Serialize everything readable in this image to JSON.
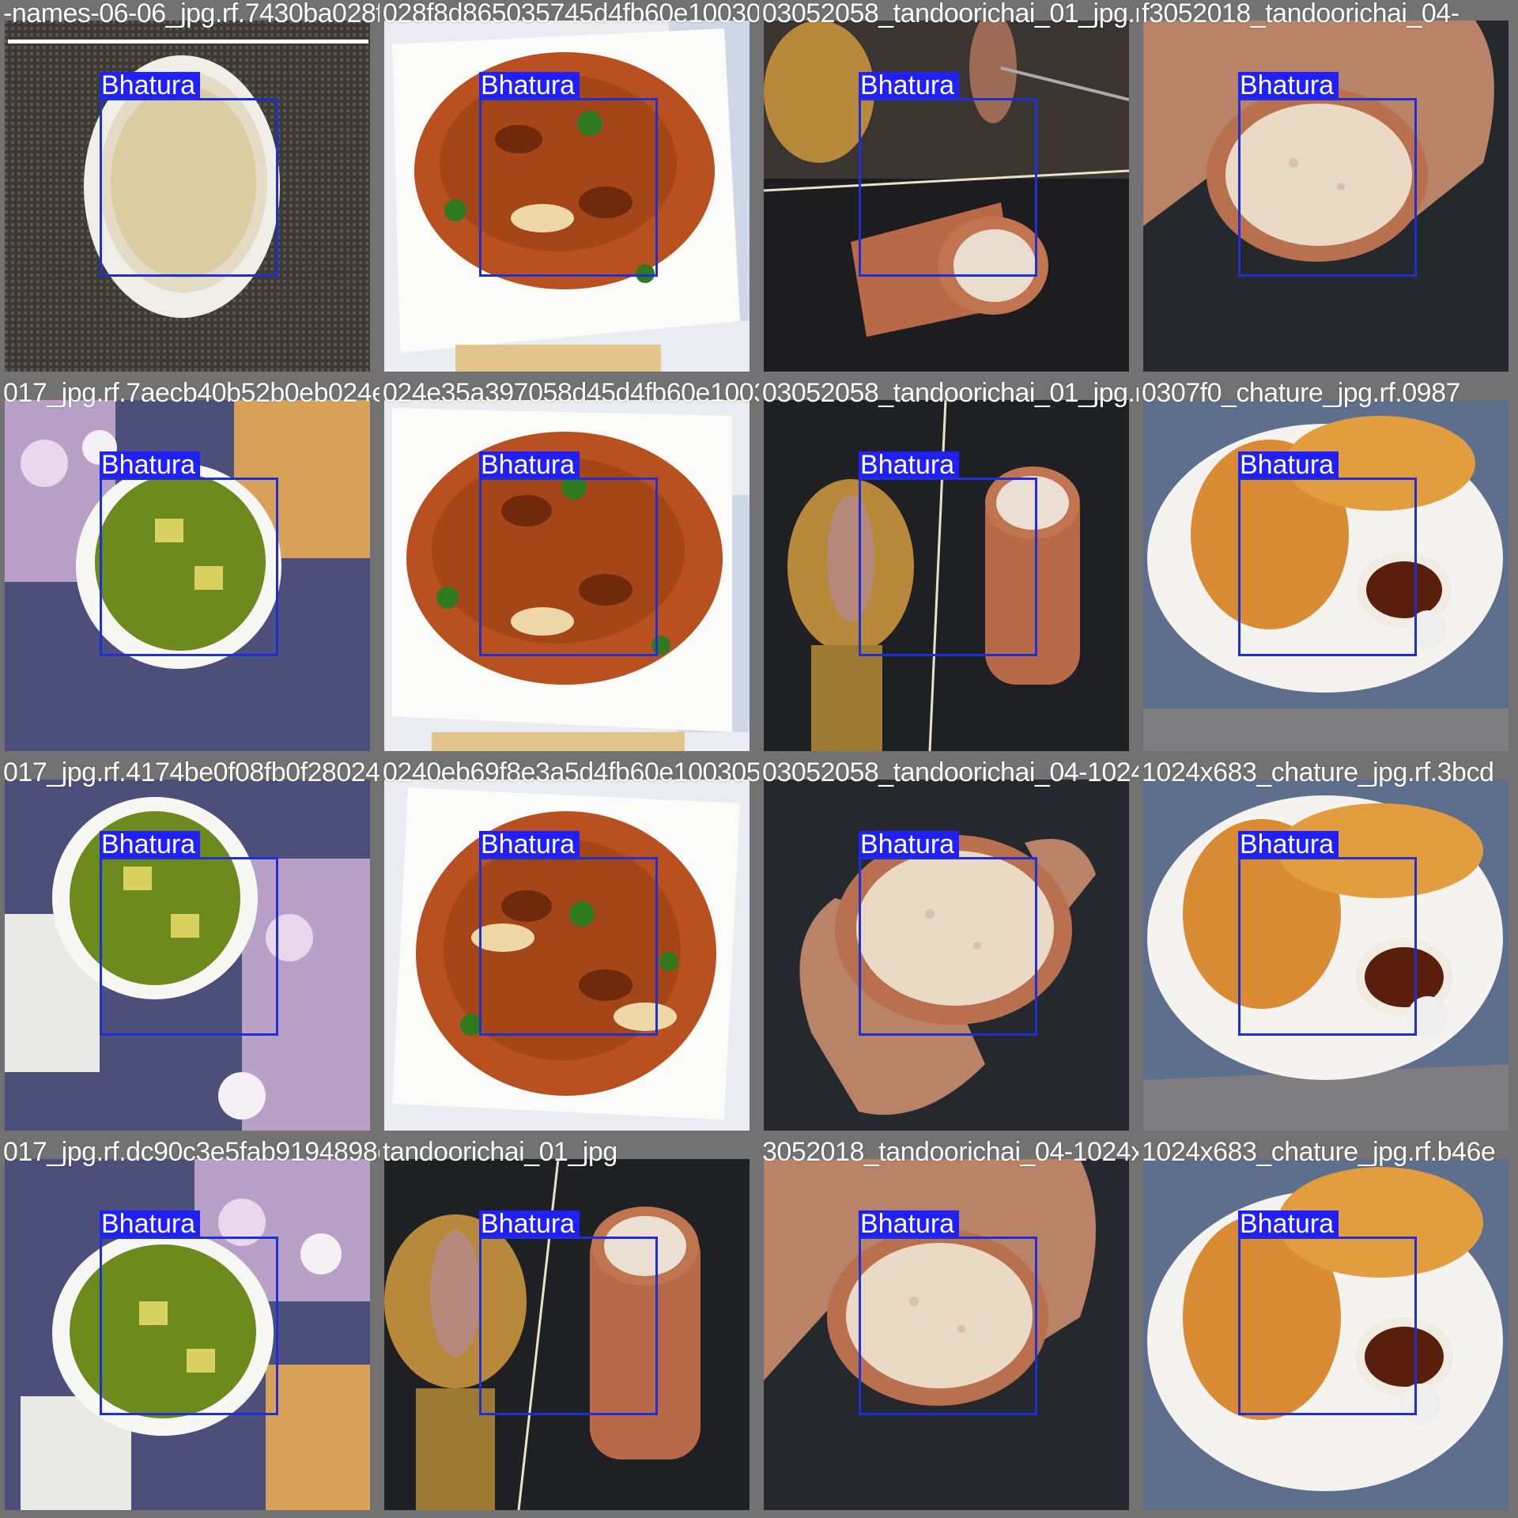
{
  "label": "Bhatura",
  "colors": {
    "box": "#1f2fd6",
    "label_bg": "#1f1fff",
    "grid_bg": "#727272"
  },
  "tiles": [
    {
      "filename": "-names-06-06_jpg.rf.7430ba028f8d865035745d4fb60e1003052058_jpg.d",
      "scene": "rice-bowl"
    },
    {
      "filename": "028f8d865035745d4fb60e1003052058",
      "scene": "curry"
    },
    {
      "filename": "03052058_tandoorichai_01_jpg.rf.3052018_tandoorichai_04-",
      "scene": "chai-pour"
    },
    {
      "filename": "f3052018_tandoorichai_04-",
      "scene": "chai-hand"
    },
    {
      "filename": "017_jpg.rf.7aecb40b52b0eb024e35a39705d45d4fb60e1003052058_tandoorichai_01_jpg.rf.7f0c9d2f5e_jpg.rf.0987",
      "scene": "palak"
    },
    {
      "filename": "024e35a397058d45d4fb60e1003052058",
      "scene": "curry"
    },
    {
      "filename": "03052058_tandoorichai_01_jpg.rf.7f0c9d2f5e_jpg.rf.0987",
      "scene": "chai-pour"
    },
    {
      "filename": "0307f0_chature_jpg.rf.0987",
      "scene": "bhatura"
    },
    {
      "filename": "017_jpg.rf.4174be0f08fb0f28024e35a397058d45d4fb60e1003052058_tandoorichai_04-1024x683_chature_jpg.rf.3bcd",
      "scene": "palak"
    },
    {
      "filename": "0240eb69f8e3a5d4fb60e1003052058",
      "scene": "curry"
    },
    {
      "filename": "03052058_tandoorichai_04-1024x683_chature_jpg.rf.3bcd",
      "scene": "chai-hand"
    },
    {
      "filename": "1024x683_chature_jpg.rf.3bcd",
      "scene": "bhatura"
    },
    {
      "filename": "017_jpg.rf.dc90c3e5fab9194898c8f62d5a2a4001ichai_01_jpg.rf.3052018_tandoorichai_04-1024x683_chature_jpg.rf.b46e",
      "scene": "palak"
    },
    {
      "filename": "tandoorichai_01_jpg",
      "scene": "chai-pour"
    },
    {
      "filename": "3052018_tandoorichai_04-1024x683",
      "scene": "chai-hand"
    },
    {
      "filename": "1024x683_chature_jpg.rf.b46e",
      "scene": "bhatura"
    }
  ]
}
